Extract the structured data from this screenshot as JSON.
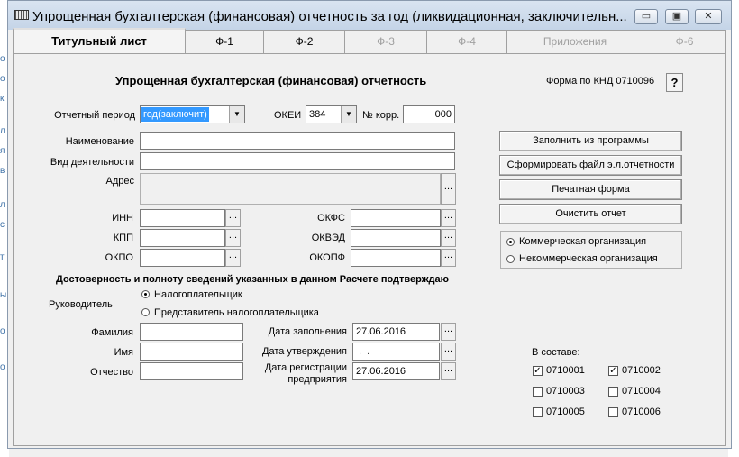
{
  "window": {
    "title": "Упрощенная бухгалтерская (финансовая) отчетность за год (ликвидационная, заключительн...",
    "minimize_glyph": "▭",
    "maximize_glyph": "▣",
    "close_glyph": "✕"
  },
  "background_fragments": [
    "о",
    "о",
    "к",
    "л",
    "я",
    "в",
    "л",
    "с",
    "т",
    "ы",
    "о",
    "о"
  ],
  "tabs": [
    {
      "label": "Титульный лист"
    },
    {
      "label": "Ф-1"
    },
    {
      "label": "Ф-2"
    },
    {
      "label": "Ф-3"
    },
    {
      "label": "Ф-4"
    },
    {
      "label": "Приложения"
    },
    {
      "label": "Ф-6"
    }
  ],
  "form": {
    "heading": "Упрощенная бухгалтерская (финансовая) отчетность",
    "knd_label": "Форма по КНД 0710096",
    "help_label": "?",
    "period_label": "Отчетный период",
    "period_value": "год(заключит)",
    "okei_label": "ОКЕИ",
    "okei_value": "384",
    "korr_label": "№ корр.",
    "korr_value": "000",
    "name_label": "Наименование",
    "name_value": "",
    "activity_label": "Вид деятельности",
    "activity_value": "",
    "address_label": "Адрес",
    "address_value": "",
    "inn_label": "ИНН",
    "kpp_label": "КПП",
    "okpo_label": "ОКПО",
    "okfs_label": "ОКФС",
    "okved_label": "ОКВЭД",
    "okopf_label": "ОКОПФ",
    "dots": "..."
  },
  "buttons": {
    "fill_from_program": "Заполнить из программы",
    "make_file": "Сформировать файл э.л.отчетности",
    "print_form": "Печатная форма",
    "clear_report": "Очистить отчет"
  },
  "org_type": {
    "commercial": "Коммерческая организация",
    "noncommercial": "Некоммерческая организация",
    "selected": "commercial"
  },
  "confirm": {
    "heading": "Достоверность и полноту сведений указанных в данном Расчете подтверждаю",
    "head_label": "Руководитель",
    "taxpayer": "Налогоплательщик",
    "representative": "Представитель налогоплательщика",
    "selected": "taxpayer",
    "surname_label": "Фамилия",
    "firstname_label": "Имя",
    "patronymic_label": "Отчество",
    "fill_date_label": "Дата заполнения",
    "fill_date_value": "27.06.2016",
    "approve_date_label": "Дата утверждения",
    "approve_date_value": " .  .",
    "reg_date_label_1": "Дата регистрации",
    "reg_date_label_2": "предприятия",
    "reg_date_value": "27.06.2016"
  },
  "composition": {
    "label": "В составе:",
    "items": [
      {
        "code": "0710001",
        "checked": true
      },
      {
        "code": "0710002",
        "checked": true
      },
      {
        "code": "0710003",
        "checked": false
      },
      {
        "code": "0710004",
        "checked": false
      },
      {
        "code": "0710005",
        "checked": false
      },
      {
        "code": "0710006",
        "checked": false
      }
    ],
    "check_glyph": "✓"
  }
}
